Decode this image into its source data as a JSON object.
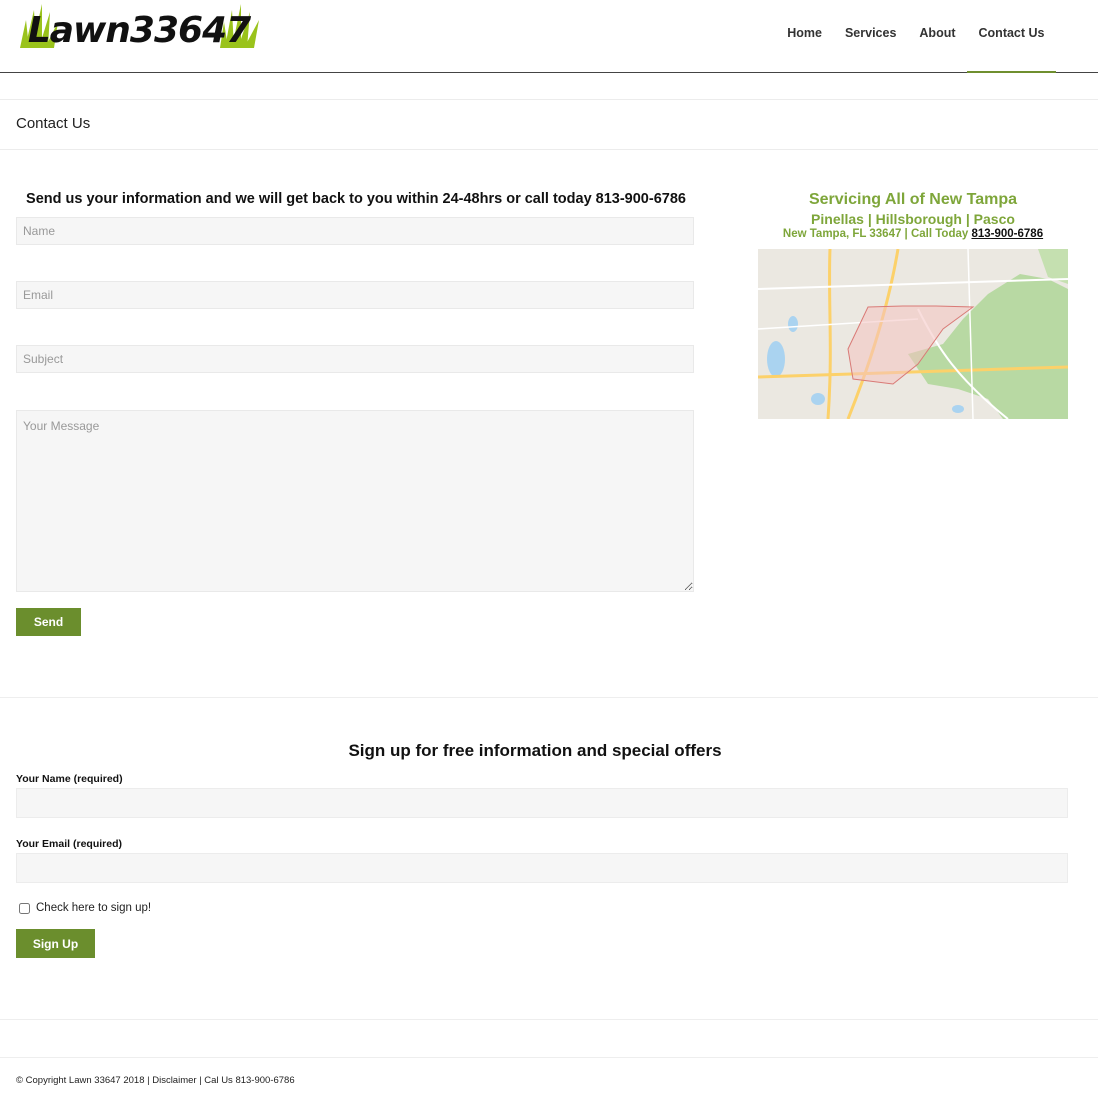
{
  "brand": {
    "logo_text": "Lawn33647"
  },
  "nav": {
    "home": "Home",
    "services": "Services",
    "about": "About",
    "contact": "Contact Us"
  },
  "page_title": "Contact Us",
  "contact_form": {
    "heading": "Send us your information and we will get back to you within 24-48hrs or call today 813-900-6786",
    "name_placeholder": "Name",
    "email_placeholder": "Email",
    "subject_placeholder": "Subject",
    "message_placeholder": "Your Message",
    "send_label": "Send"
  },
  "sidebar": {
    "line1": "Servicing All of New Tampa",
    "line2": "Pinellas | Hillsborough | Pasco",
    "line3_prefix": "New Tampa, FL 33647 | Call Today ",
    "phone": "813-900-6786"
  },
  "signup": {
    "heading": "Sign up for free information and special offers",
    "name_label": "Your Name (required)",
    "email_label": "Your Email (required)",
    "checkbox_label": "Check here to sign up!",
    "button_label": "Sign Up"
  },
  "footer": {
    "copyright": "© Copyright Lawn 33647 2018 | Disclaimer | Cal Us 813-900-6786"
  },
  "colors": {
    "accent_green": "#6b8e2d",
    "sidebar_green": "#7ea63a",
    "logo_green": "#9ac31c"
  }
}
